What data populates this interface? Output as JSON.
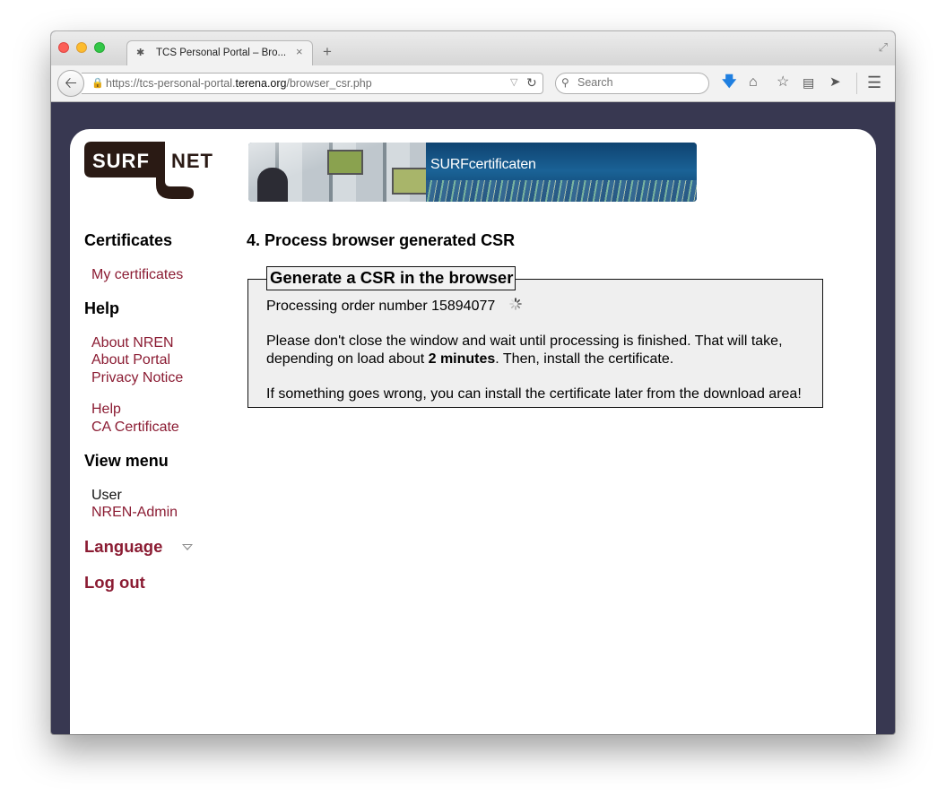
{
  "browser": {
    "tab_title": "TCS Personal Portal – Bro...",
    "url_prefix": "https://tcs-personal-portal.",
    "url_domain": "terena.org",
    "url_path": "/browser_csr.php",
    "search_placeholder": "Search"
  },
  "header": {
    "logo_left": "SURF",
    "logo_right": "NET",
    "banner_text": "SURFcertificaten"
  },
  "sidebar": {
    "certificates_heading": "Certificates",
    "my_certificates": "My certificates",
    "help_heading": "Help",
    "about_nren": "About NREN",
    "about_portal": "About Portal",
    "privacy_notice": "Privacy Notice",
    "help_link": "Help",
    "ca_certificate": "CA Certificate",
    "view_menu_heading": "View menu",
    "view_user": "User",
    "view_nren_admin": "NREN-Admin",
    "language": "Language",
    "logout": "Log out"
  },
  "main": {
    "title": "4. Process browser generated CSR",
    "legend": "Generate a CSR in the browser",
    "processing_text": "Processing order number 15894077",
    "wait_line1": "Please don't close the window and wait until processing is finished. That will take,",
    "wait_line2_before": "depending on load about ",
    "wait_line2_bold": "2 minutes",
    "wait_line2_after": ". Then, install the certificate.",
    "error_text": "If something goes wrong, you can install the certificate later from the download area!"
  },
  "colors": {
    "link": "#8b1c33",
    "chrome_background": "#383851",
    "logo_dark": "#2a1a14"
  }
}
